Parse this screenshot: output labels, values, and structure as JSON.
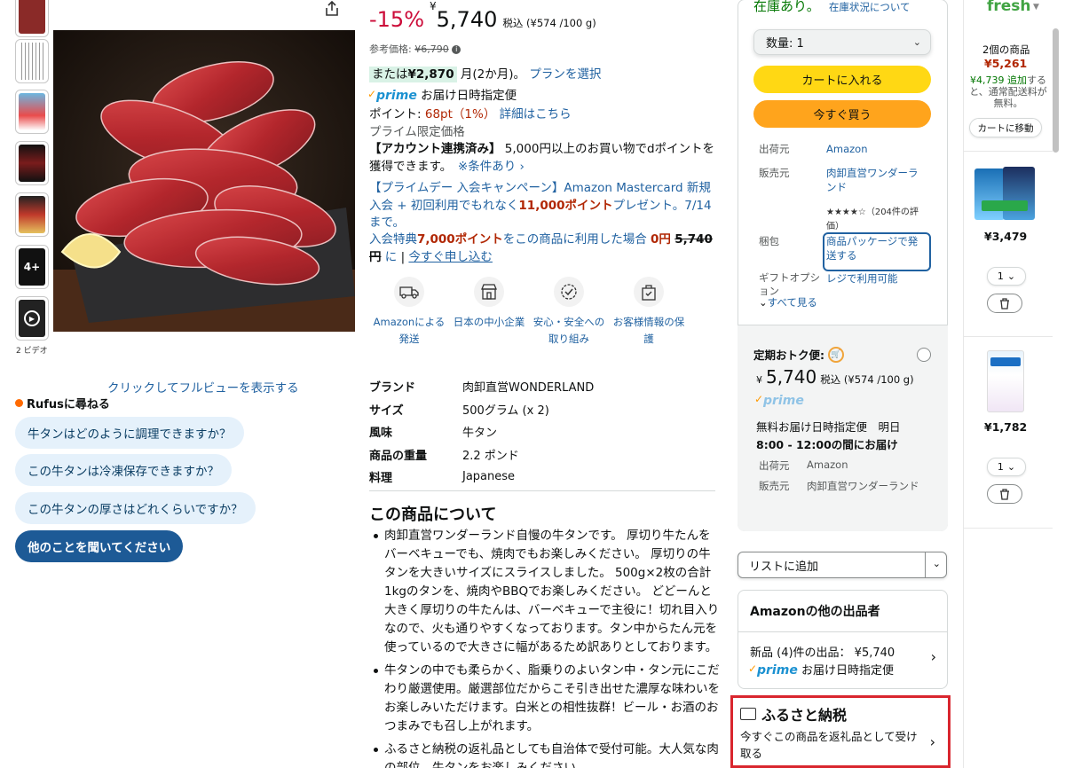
{
  "thumbnails": {
    "video_label": "2 ビデオ"
  },
  "gallery": {
    "fullview_link": "クリックしてフルビューを表示する"
  },
  "rufus": {
    "title": "Rufusに尋ねる",
    "questions": [
      "牛タンはどのように調理できますか？",
      "この牛タンは冷凍保存できますか？",
      "この牛タンの厚さはどれくらいですか？"
    ],
    "ask_button": "他のことを聞いてください"
  },
  "price": {
    "discount": "-15%",
    "yen": "¥",
    "amount": "5,740",
    "tax_note": "税込 (¥574 /100 g)",
    "ref_label": "参考価格:",
    "ref_price": "¥6,790",
    "installment_prefix": "または",
    "installment_amount": "¥2,870",
    "installment_suffix": "月(2か月)。",
    "plan_link": "プランを選択",
    "prime_text": "prime",
    "prime_delivery": "お届け日時指定便",
    "points_label": "ポイント:",
    "points_value": "68pt（1%）",
    "points_link": "詳細はこちら",
    "prime_only": "プライム限定価格"
  },
  "promos": {
    "dpoint_bold": "【アカウント連携済み】",
    "dpoint_text": " 5,000円以上のお買い物でdポイントを獲得できます。",
    "dpoint_link": "※条件あり",
    "mc_text1": "【プライムデー 入会キャンペーン】Amazon Mastercard 新規入会 + 初回利用でもれなく",
    "mc_points": "11,000ポイント",
    "mc_text2": "プレゼント。7/14まで。",
    "benefit_text1": "入会特典",
    "benefit_points": "7,000ポイント",
    "benefit_text2": "をこの商品に利用した場合",
    "benefit_price": "0円",
    "benefit_strike": "5,740円",
    "benefit_text3": "に",
    "benefit_link": "今すぐ申し込む"
  },
  "features": [
    {
      "icon": "truck-icon",
      "label": "Amazonによる発送"
    },
    {
      "icon": "store-icon",
      "label": "日本の中小企業"
    },
    {
      "icon": "shield-badge-icon",
      "label": "安心・安全への取り組み"
    },
    {
      "icon": "lock-bag-icon",
      "label": "お客様情報の保護"
    }
  ],
  "specs": [
    {
      "key": "ブランド",
      "value": "肉卸直営WONDERLAND"
    },
    {
      "key": "サイズ",
      "value": "500グラム (x 2)"
    },
    {
      "key": "風味",
      "value": "牛タン"
    },
    {
      "key": "商品の重量",
      "value": "2.2 ポンド"
    },
    {
      "key": "料理",
      "value": "Japanese"
    }
  ],
  "about": {
    "title": "この商品について",
    "bullets": [
      "肉卸直営ワンダーランド自慢の牛タンです。 厚切り牛たんをバーベキューでも、焼肉でもお楽しみください。 厚切りの牛タンを大きいサイズにスライスしました。 500g×2枚の合計1kgのタンを、焼肉やBBQでお楽しみください。 どどーんと大きく厚切りの牛たんは、バーベキューで主役に！切れ目入りなので、火も通りやすくなっております。タン中からたん元を使っているので大きさに幅があるため訳ありとしております。",
      "牛タンの中でも柔らかく、脂乗りのよいタン中・タン元にこだわり厳選使用。厳選部位だからこそ引き出せた濃厚な味わいをお楽しみいただけます。白米との相性抜群！ビール・お酒のおつまみでも召し上がれます。",
      "ふるさと納税の返礼品としても自治体で受付可能。大人気な肉の部位、牛タンをお楽しみください。"
    ]
  },
  "buybox": {
    "stock": "在庫あり。",
    "stock_link": "在庫状況について",
    "qty": "数量: 1",
    "cart_button": "カートに入れる",
    "buy_button": "今すぐ買う",
    "ship_label": "出荷元",
    "ship_value": "Amazon",
    "seller_label": "販売元",
    "seller_value": "肉卸直営ワンダーランド",
    "rating": "★★★★☆",
    "rating_text": "（204件の評価）",
    "pack_label": "梱包",
    "pack_value": "商品パッケージで発送する",
    "gift_label": "ギフトオプション",
    "gift_value": "レジで利用可能",
    "see_all": "すべて見る"
  },
  "subscription": {
    "title": "定期おトク便:",
    "yen": "¥",
    "price": "5,740",
    "tax_note": "税込 (¥574 /100 g)",
    "prime": "prime",
    "delivery_line1": "無料お届け日時指定便　明日",
    "delivery_line2": "8:00 - 12:00の間にお届け",
    "ship_label": "出荷元",
    "ship_value": "Amazon",
    "seller_label": "販売元",
    "seller_value": "肉卸直営ワンダーランド"
  },
  "list_add": "リストに追加",
  "other_sellers": {
    "title": "Amazonの他の出品者",
    "line1": "新品 (4)件の出品：  ¥5,740",
    "prime": "prime",
    "line2": "お届け日時指定便"
  },
  "furusato": {
    "title": "ふるさと納税",
    "desc": "今すぐこの商品を返礼品として受け取る"
  },
  "rail": {
    "fresh": "fresh",
    "count": "2個の商品",
    "total": "¥5,261",
    "note_green": "¥4,739 追加",
    "note_rest": "すると、通常配送料が無料。",
    "move_button": "カートに移動",
    "items": [
      {
        "price": "¥3,479",
        "qty": "1"
      },
      {
        "price": "¥1,782",
        "qty": "1"
      }
    ]
  },
  "colors": {
    "accent_link": "#2162a1",
    "discount_red": "#cc0c39",
    "cart_yellow": "#ffd814",
    "buy_orange": "#ffa41c",
    "highlight_red": "#d9262e"
  }
}
